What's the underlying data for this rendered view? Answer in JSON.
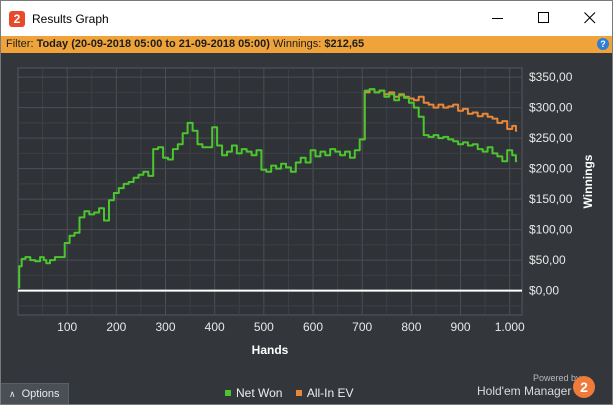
{
  "window": {
    "title": "Results Graph",
    "icon_glyph": "2",
    "icon": "hem-logo-icon"
  },
  "filter": {
    "label": "Filter:",
    "range": "Today (20-09-2018 05:00 to 21-09-2018 05:00)",
    "winnings_label": "Winnings:",
    "winnings_value": "$212,65",
    "help_glyph": "?"
  },
  "footer": {
    "options_label": "Options",
    "powered_by": "Powered by",
    "brand": "Hold'em Manager",
    "brand_glyph": "2"
  },
  "colors": {
    "net_won": "#4cc62e",
    "all_in_ev": "#e8873a",
    "zero_line": "#ffffff",
    "accent": "#f0a33a"
  },
  "chart_data": {
    "type": "line",
    "title": "",
    "xlabel": "Hands",
    "ylabel": "Winnings",
    "xlim": [
      0,
      1025
    ],
    "ylim": [
      -40,
      365
    ],
    "x_ticks": [
      100,
      200,
      300,
      400,
      500,
      600,
      700,
      800,
      900,
      1000
    ],
    "x_tick_labels": [
      "100",
      "200",
      "300",
      "400",
      "500",
      "600",
      "700",
      "800",
      "900",
      "1.000"
    ],
    "y_ticks": [
      0,
      50,
      100,
      150,
      200,
      250,
      300,
      350
    ],
    "y_tick_labels": [
      "$0,00",
      "$50,00",
      "$100,00",
      "$150,00",
      "$200,00",
      "$250,00",
      "$300,00",
      "$350,00"
    ],
    "grid": true,
    "legend_position": "bottom",
    "series": [
      {
        "name": "Net Won",
        "x": [
          0,
          5,
          10,
          20,
          30,
          40,
          50,
          55,
          60,
          70,
          80,
          90,
          100,
          110,
          120,
          130,
          140,
          150,
          160,
          170,
          180,
          190,
          200,
          210,
          220,
          230,
          240,
          250,
          260,
          270,
          280,
          290,
          300,
          310,
          320,
          330,
          340,
          350,
          360,
          370,
          380,
          390,
          400,
          410,
          420,
          430,
          440,
          450,
          460,
          470,
          480,
          490,
          500,
          510,
          520,
          530,
          540,
          550,
          560,
          570,
          580,
          590,
          600,
          610,
          620,
          630,
          640,
          650,
          660,
          670,
          680,
          690,
          700,
          710,
          720,
          730,
          740,
          750,
          760,
          770,
          780,
          790,
          800,
          810,
          820,
          830,
          840,
          850,
          860,
          870,
          880,
          890,
          900,
          910,
          920,
          930,
          940,
          950,
          960,
          970,
          980,
          990,
          1000,
          1010,
          1015
        ],
        "y": [
          5,
          40,
          52,
          55,
          50,
          48,
          55,
          50,
          45,
          50,
          55,
          55,
          78,
          90,
          95,
          120,
          130,
          125,
          128,
          135,
          115,
          148,
          160,
          168,
          175,
          178,
          185,
          190,
          195,
          188,
          232,
          235,
          218,
          215,
          232,
          240,
          258,
          275,
          262,
          240,
          235,
          235,
          268,
          238,
          222,
          228,
          238,
          225,
          232,
          228,
          222,
          230,
          198,
          195,
          205,
          200,
          208,
          202,
          195,
          210,
          218,
          210,
          230,
          220,
          228,
          222,
          232,
          228,
          222,
          228,
          218,
          230,
          248,
          328,
          330,
          325,
          328,
          318,
          322,
          312,
          320,
          316,
          308,
          300,
          285,
          255,
          252,
          255,
          250,
          252,
          248,
          245,
          240,
          243,
          238,
          240,
          232,
          228,
          235,
          225,
          220,
          212,
          230,
          222,
          212
        ]
      },
      {
        "name": "All-In EV",
        "x": [
          700,
          710,
          720,
          730,
          740,
          750,
          760,
          770,
          780,
          790,
          800,
          810,
          820,
          830,
          840,
          850,
          860,
          870,
          880,
          890,
          900,
          910,
          920,
          930,
          940,
          950,
          960,
          970,
          980,
          990,
          1000,
          1010,
          1015
        ],
        "y": [
          248,
          325,
          330,
          325,
          328,
          322,
          325,
          318,
          322,
          318,
          315,
          312,
          318,
          308,
          305,
          300,
          305,
          300,
          302,
          305,
          295,
          298,
          290,
          292,
          286,
          290,
          285,
          282,
          275,
          278,
          265,
          270,
          262
        ]
      }
    ]
  }
}
